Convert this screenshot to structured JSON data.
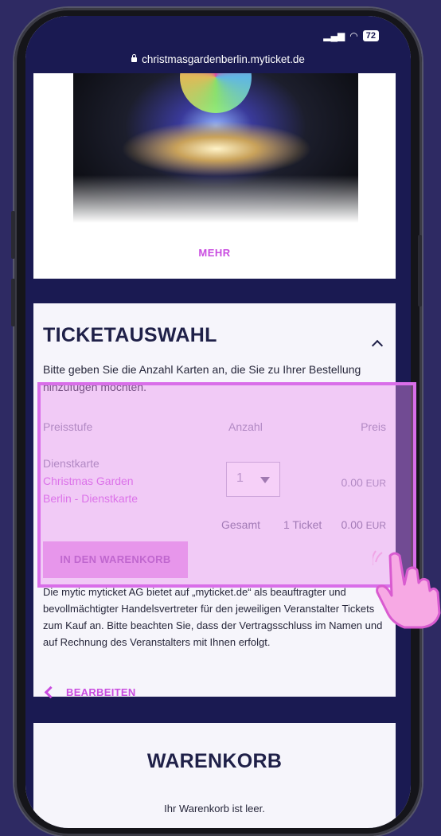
{
  "browser": {
    "url": "christmasgardenberlin.myticket.de",
    "battery": "72"
  },
  "hero": {
    "more_label": "MEHR"
  },
  "ticket_section": {
    "title": "TICKETAUSWAHL",
    "intro": "Bitte geben Sie die Anzahl Karten an, die Sie zu Ihrer Bestellung hinzufügen möchten.",
    "headers": {
      "price_level": "Preisstufe",
      "quantity": "Anzahl",
      "price": "Preis"
    },
    "item": {
      "type": "Dienstkarte",
      "name_line1": "Christmas Garden",
      "name_line2": "Berlin - Dienstkarte",
      "quantity": "1",
      "price": "0.00",
      "currency": "EUR"
    },
    "total": {
      "label": "Gesamt",
      "tickets": "1 Ticket",
      "amount": "0.00",
      "currency": "EUR"
    },
    "add_to_cart_label": "IN DEN WARENKORB",
    "legal_text": "Die mytic myticket AG bietet auf „myticket.de“ als beauftragter und bevollmächtigter Handelsvertreter für den jeweiligen Veranstalter Tickets zum Kauf an. Bitte beachten Sie, dass der Vertragsschluss im Namen und auf Rechnung des Veranstalters mit Ihnen erfolgt.",
    "edit_label": "BEARBEITEN"
  },
  "cart": {
    "title": "WARENKORB",
    "empty_text": "Ihr Warenkorb ist leer."
  },
  "colors": {
    "accent": "#c94ce0",
    "navy": "#1a1a52",
    "background": "#2e2a63",
    "highlight": "#d96ee9"
  }
}
